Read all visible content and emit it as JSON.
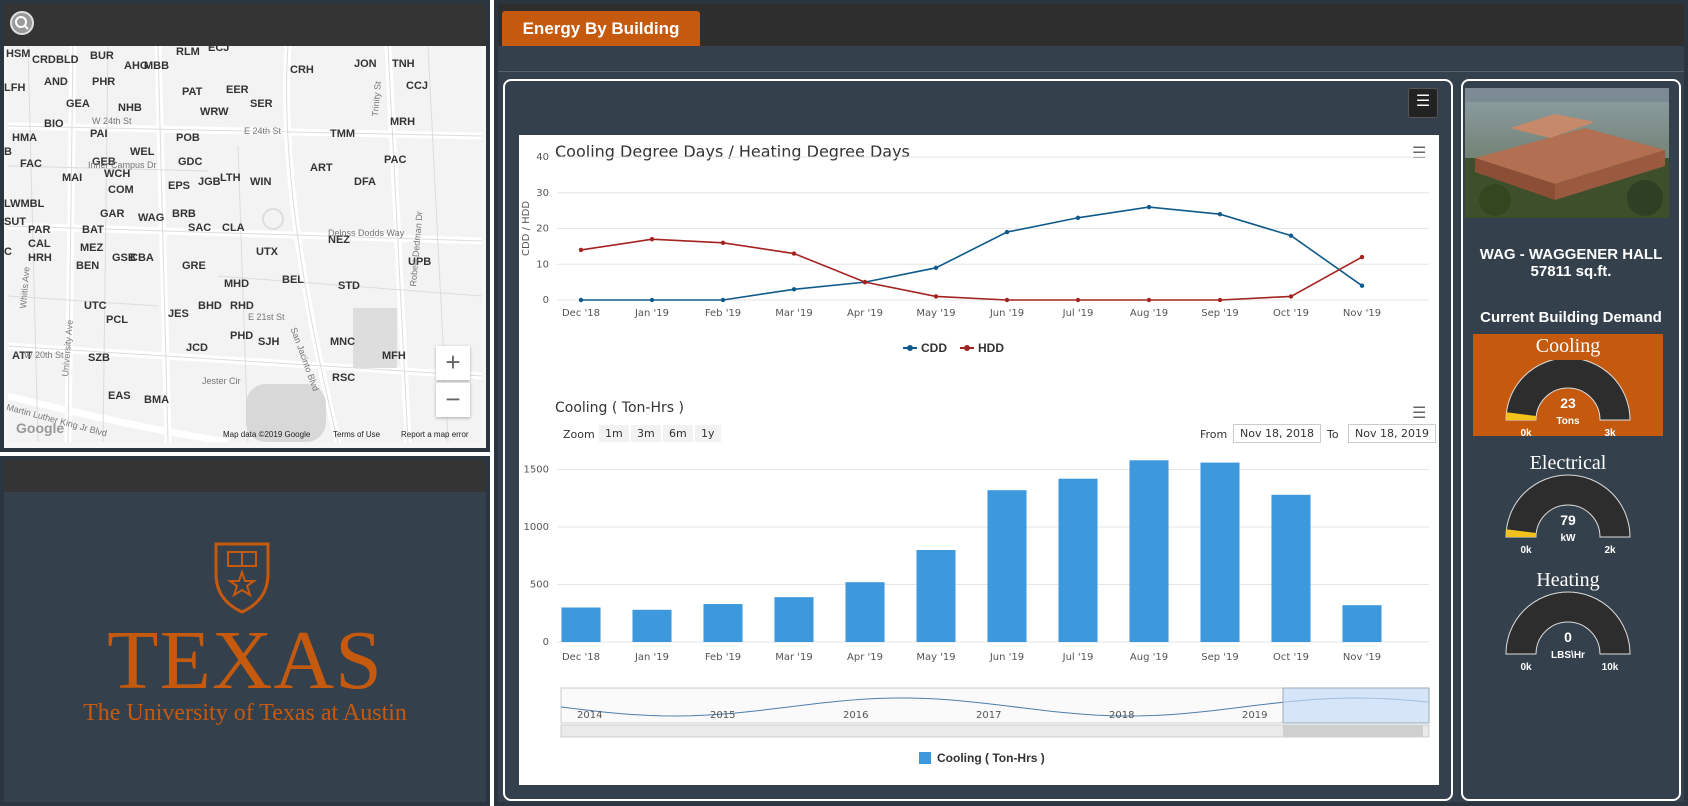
{
  "map": {
    "labels": [
      {
        "t": "HSM"
      },
      {
        "t": "CRD"
      },
      {
        "t": "BLD"
      },
      {
        "t": "BUR"
      },
      {
        "t": "RLM"
      },
      {
        "t": "ECJ"
      },
      {
        "t": "AHG"
      },
      {
        "t": "MBB"
      },
      {
        "t": "JON"
      },
      {
        "t": "TNH"
      },
      {
        "t": "CRH"
      },
      {
        "t": "LFH"
      },
      {
        "t": "AND"
      },
      {
        "t": "PHR"
      },
      {
        "t": "PAT"
      },
      {
        "t": "EER"
      },
      {
        "t": "CCJ"
      },
      {
        "t": "GEA"
      },
      {
        "t": "NHB"
      },
      {
        "t": "WRW"
      },
      {
        "t": "SER"
      },
      {
        "t": "MRH"
      },
      {
        "t": "BIO"
      },
      {
        "t": "PAI"
      },
      {
        "t": "POB"
      },
      {
        "t": "TMM"
      },
      {
        "t": "HMA"
      },
      {
        "t": "B"
      },
      {
        "t": "WEL"
      },
      {
        "t": "GDC"
      },
      {
        "t": "PAC"
      },
      {
        "t": "FAC"
      },
      {
        "t": "GEB"
      },
      {
        "t": "WCH"
      },
      {
        "t": "MAI"
      },
      {
        "t": "EPS"
      },
      {
        "t": "JGB"
      },
      {
        "t": "LTH"
      },
      {
        "t": "WIN"
      },
      {
        "t": "ART"
      },
      {
        "t": "DFA"
      },
      {
        "t": "COM"
      },
      {
        "t": "LWMBL"
      },
      {
        "t": "GAR"
      },
      {
        "t": "WAG"
      },
      {
        "t": "BRB"
      },
      {
        "t": "SUT"
      },
      {
        "t": "SAC"
      },
      {
        "t": "CLA"
      },
      {
        "t": "PAR"
      },
      {
        "t": "BAT"
      },
      {
        "t": "NEZ"
      },
      {
        "t": "CAL"
      },
      {
        "t": "MEZ"
      },
      {
        "t": "UTX"
      },
      {
        "t": "HRH"
      },
      {
        "t": "GSB"
      },
      {
        "t": "CBA"
      },
      {
        "t": "C"
      },
      {
        "t": "BEN"
      },
      {
        "t": "GRE"
      },
      {
        "t": "UPB"
      },
      {
        "t": "BEL"
      },
      {
        "t": "STD"
      },
      {
        "t": "MHD"
      },
      {
        "t": "UTC"
      },
      {
        "t": "BHD"
      },
      {
        "t": "RHD"
      },
      {
        "t": "PCL"
      },
      {
        "t": "JES"
      },
      {
        "t": "PHD"
      },
      {
        "t": "SJH"
      },
      {
        "t": "MNC"
      },
      {
        "t": "JCD"
      },
      {
        "t": "ATT"
      },
      {
        "t": "SZB"
      },
      {
        "t": "MFH"
      },
      {
        "t": "RSC"
      },
      {
        "t": "EAS"
      },
      {
        "t": "BMA"
      }
    ],
    "streets": [
      "W 24th St",
      "E 24th St",
      "Inner Campus Dr",
      "Deloss Dodds Way",
      "E 21st St",
      "W 20th St",
      "Jester Cir",
      "San Jacinto Blvd",
      "Robert Dedman Dr",
      "Trinity St",
      "University Ave",
      "Whitis Ave",
      "Martin Luther King Jr Blvd"
    ],
    "zoom_in": "+",
    "zoom_out": "−",
    "footer": {
      "google": "Google",
      "data": "Map data ©2019 Google",
      "terms": "Terms of Use",
      "report": "Report a map error"
    }
  },
  "logo": {
    "wordmark": "TEXAS",
    "subtitle": "The University of Texas at Austin"
  },
  "tab": {
    "label": "Energy By Building"
  },
  "degree_chart": {
    "title": "Cooling Degree Days  /  Heating Degree Days",
    "ylabel": "CDD / HDD",
    "yticks": [
      "0",
      "10",
      "20",
      "30",
      "40"
    ],
    "xticks": [
      "Dec '18",
      "Jan '19",
      "Feb '19",
      "Mar '19",
      "Apr '19",
      "May '19",
      "Jun '19",
      "Jul '19",
      "Aug '19",
      "Sep '19",
      "Oct '19",
      "Nov '19"
    ],
    "legend": [
      "CDD",
      "HDD"
    ]
  },
  "cooling_chart": {
    "title": "Cooling ( Ton-Hrs )",
    "zoom_label": "Zoom",
    "zoom_buttons": [
      "1m",
      "3m",
      "6m",
      "1y"
    ],
    "from_label": "From",
    "from_value": "Nov 18, 2018",
    "to_label": "To",
    "to_value": "Nov 18, 2019",
    "yticks": [
      "0",
      "500",
      "1000",
      "1500"
    ],
    "xticks": [
      "Dec '18",
      "Jan '19",
      "Feb '19",
      "Mar '19",
      "Apr '19",
      "May '19",
      "Jun '19",
      "Jul '19",
      "Aug '19",
      "Sep '19",
      "Oct '19",
      "Nov '19"
    ],
    "navigator_years": [
      "2014",
      "2015",
      "2016",
      "2017",
      "2018",
      "2019"
    ],
    "legend": "Cooling ( Ton-Hrs )"
  },
  "chart_data": [
    {
      "type": "line",
      "title": "Cooling Degree Days  /  Heating Degree Days",
      "ylabel": "CDD / HDD",
      "ylim": [
        0,
        40
      ],
      "x": [
        "Dec '18",
        "Jan '19",
        "Feb '19",
        "Mar '19",
        "Apr '19",
        "May '19",
        "Jun '19",
        "Jul '19",
        "Aug '19",
        "Sep '19",
        "Oct '19",
        "Nov '19"
      ],
      "series": [
        {
          "name": "CDD",
          "color": "#0f5a8a",
          "values": [
            0,
            0,
            0,
            3,
            5,
            9,
            19,
            23,
            26,
            24,
            18,
            4
          ]
        },
        {
          "name": "HDD",
          "color": "#a3231f",
          "values": [
            14,
            17,
            16,
            13,
            5,
            1,
            0,
            0,
            0,
            0,
            1,
            12
          ]
        }
      ]
    },
    {
      "type": "bar",
      "title": "Cooling ( Ton-Hrs )",
      "ylim": [
        0,
        1800
      ],
      "categories": [
        "Dec '18",
        "Jan '19",
        "Feb '19",
        "Mar '19",
        "Apr '19",
        "May '19",
        "Jun '19",
        "Jul '19",
        "Aug '19",
        "Sep '19",
        "Oct '19",
        "Nov '19"
      ],
      "series": [
        {
          "name": "Cooling ( Ton-Hrs )",
          "color": "#3d98dd",
          "values": [
            300,
            280,
            330,
            390,
            520,
            800,
            1320,
            1420,
            1580,
            1560,
            1280,
            320
          ]
        }
      ]
    },
    {
      "type": "gauge",
      "title": "Cooling",
      "value": 23,
      "unit": "Tons",
      "min_label": "0k",
      "max_label": "3k",
      "max": 3000
    },
    {
      "type": "gauge",
      "title": "Electrical",
      "value": 79,
      "unit": "kW",
      "min_label": "0k",
      "max_label": "2k",
      "max": 2000
    },
    {
      "type": "gauge",
      "title": "Heating",
      "value": 0,
      "unit": "LBS\\Hr",
      "min_label": "0k",
      "max_label": "10k",
      "max": 10000
    }
  ],
  "building": {
    "name": "WAG - WAGGENER HALL",
    "area": "57811 sq.ft.",
    "demand_title": "Current Building Demand"
  },
  "colors": {
    "accent": "#c55a0f",
    "panel": "#34404b",
    "cdd": "#0f5a8a",
    "hdd": "#a3231f",
    "bars": "#3d98dd",
    "gauge_fill": "#f2c21a"
  }
}
